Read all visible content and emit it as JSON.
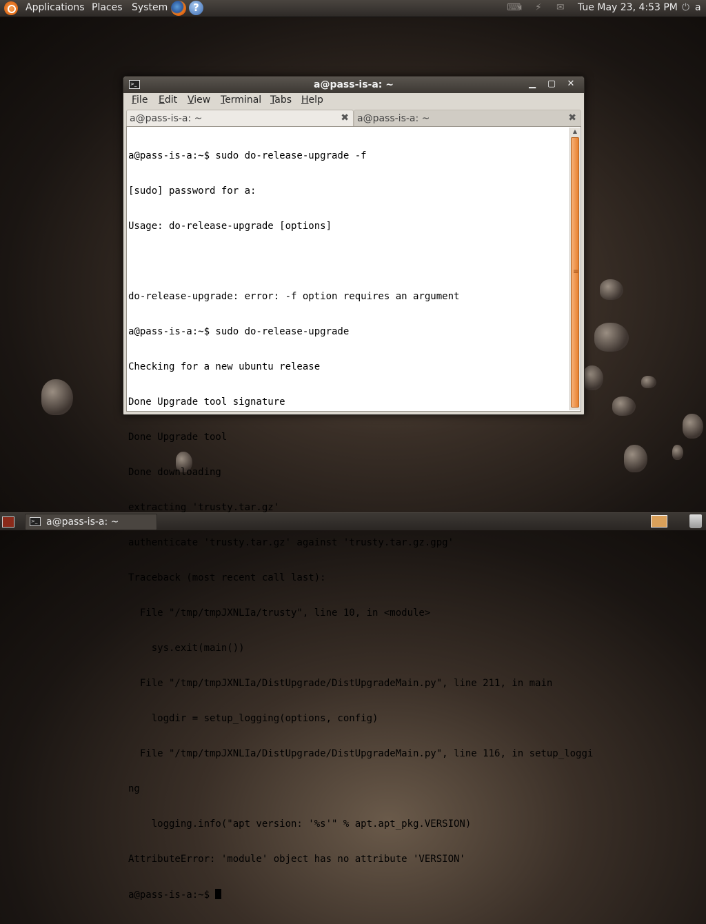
{
  "top_panel": {
    "menus": [
      "Applications",
      "Places",
      "System"
    ],
    "clock": "Tue May 23,  4:53 PM",
    "user": "a",
    "help_glyph": "?"
  },
  "window": {
    "title": "a@pass-is-a: ~",
    "menus": [
      {
        "label": "File",
        "mnemonic": "F",
        "rest": "ile"
      },
      {
        "label": "Edit",
        "mnemonic": "E",
        "rest": "dit"
      },
      {
        "label": "View",
        "mnemonic": "V",
        "rest": "iew"
      },
      {
        "label": "Terminal",
        "mnemonic": "T",
        "rest": "erminal"
      },
      {
        "label": "Tabs",
        "mnemonic": "T",
        "rest": "abs"
      },
      {
        "label": "Help",
        "mnemonic": "H",
        "rest": "elp"
      }
    ],
    "tabs": [
      {
        "label": "a@pass-is-a: ~",
        "active": true
      },
      {
        "label": "a@pass-is-a: ~",
        "active": false
      }
    ],
    "terminal_lines": [
      "a@pass-is-a:~$ sudo do-release-upgrade -f",
      "[sudo] password for a:",
      "Usage: do-release-upgrade [options]",
      "",
      "do-release-upgrade: error: -f option requires an argument",
      "a@pass-is-a:~$ sudo do-release-upgrade",
      "Checking for a new ubuntu release",
      "Done Upgrade tool signature",
      "Done Upgrade tool",
      "Done downloading",
      "extracting 'trusty.tar.gz'",
      "authenticate 'trusty.tar.gz' against 'trusty.tar.gz.gpg'",
      "Traceback (most recent call last):",
      "  File \"/tmp/tmpJXNLIa/trusty\", line 10, in <module>",
      "    sys.exit(main())",
      "  File \"/tmp/tmpJXNLIa/DistUpgrade/DistUpgradeMain.py\", line 211, in main",
      "    logdir = setup_logging(options, config)",
      "  File \"/tmp/tmpJXNLIa/DistUpgrade/DistUpgradeMain.py\", line 116, in setup_loggi",
      "ng",
      "    logging.info(\"apt version: '%s'\" % apt.apt_pkg.VERSION)",
      "AttributeError: 'module' object has no attribute 'VERSION'"
    ],
    "prompt": "a@pass-is-a:~$ "
  },
  "bottom_panel": {
    "task_label": "a@pass-is-a: ~"
  },
  "colors": {
    "accent_orange": "#e8812f",
    "panel_dark": "#2e2a27",
    "terminal_bg": "#ffffff"
  },
  "icons": [
    "ubuntu-logo-icon",
    "firefox-icon",
    "help-icon",
    "keyboard-icon",
    "volume-icon",
    "network-icon",
    "mail-icon",
    "power-icon",
    "terminal-icon",
    "minimize-icon",
    "maximize-icon",
    "close-icon",
    "show-desktop-icon",
    "workspace-icon",
    "trash-icon"
  ]
}
